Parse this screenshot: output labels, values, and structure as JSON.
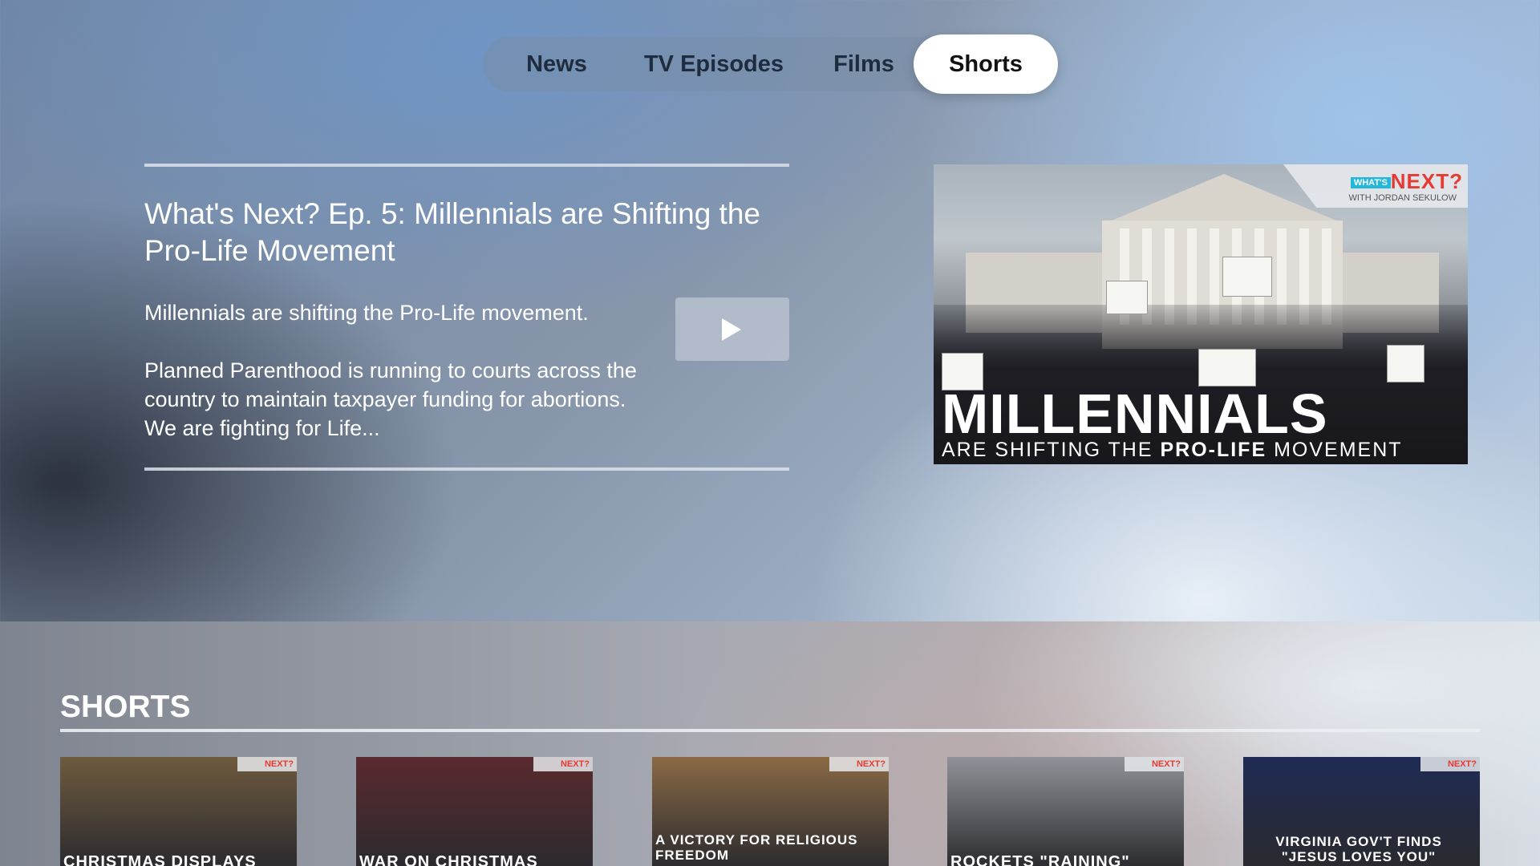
{
  "tabs": [
    {
      "label": "News",
      "active": false
    },
    {
      "label": "TV Episodes",
      "active": false
    },
    {
      "label": "Films",
      "active": false
    },
    {
      "label": "Shorts",
      "active": true
    }
  ],
  "featured": {
    "title": "What's Next? Ep. 5: Millennials are Shifting the Pro-Life Movement",
    "description_line": "Millennials are shifting the Pro-Life movement.",
    "description_body": "Planned Parenthood is running to courts across the country to maintain taxpayer funding for abortions. We are fighting for Life...",
    "play_icon": "play-icon",
    "image": {
      "logo_prefix": "WHAT'S",
      "logo_main": "NEXT?",
      "logo_sub": "WITH JORDAN SEKULOW",
      "headline": "MILLENNIALS",
      "subline_pre": "ARE SHIFTING THE",
      "subline_bold": "PRO-LIFE",
      "subline_post": "MOVEMENT"
    }
  },
  "shelf": {
    "title": "SHORTS",
    "cards": [
      {
        "caption": "CHRISTMAS DISPLAYS",
        "logo": "NEXT?",
        "color": "#6e5a3e"
      },
      {
        "caption": "WAR ON CHRISTMAS",
        "logo": "NEXT?",
        "color": "#5a2a2e"
      },
      {
        "caption": "A VICTORY FOR RELIGIOUS FREEDOM",
        "logo": "NEXT?",
        "color": "#8a6a45"
      },
      {
        "caption": "ROCKETS \"RAINING\"",
        "logo": "NEXT?",
        "color": "#8f9398"
      },
      {
        "caption": "VIRGINIA GOV'T FINDS \"JESUS LOVES YOU\"",
        "logo": "NEXT?",
        "color": "#1f2b55"
      }
    ]
  },
  "colors": {
    "accent_red": "#e63a32",
    "accent_cyan": "#23b7d9",
    "active_tab_bg": "#ffffff"
  }
}
